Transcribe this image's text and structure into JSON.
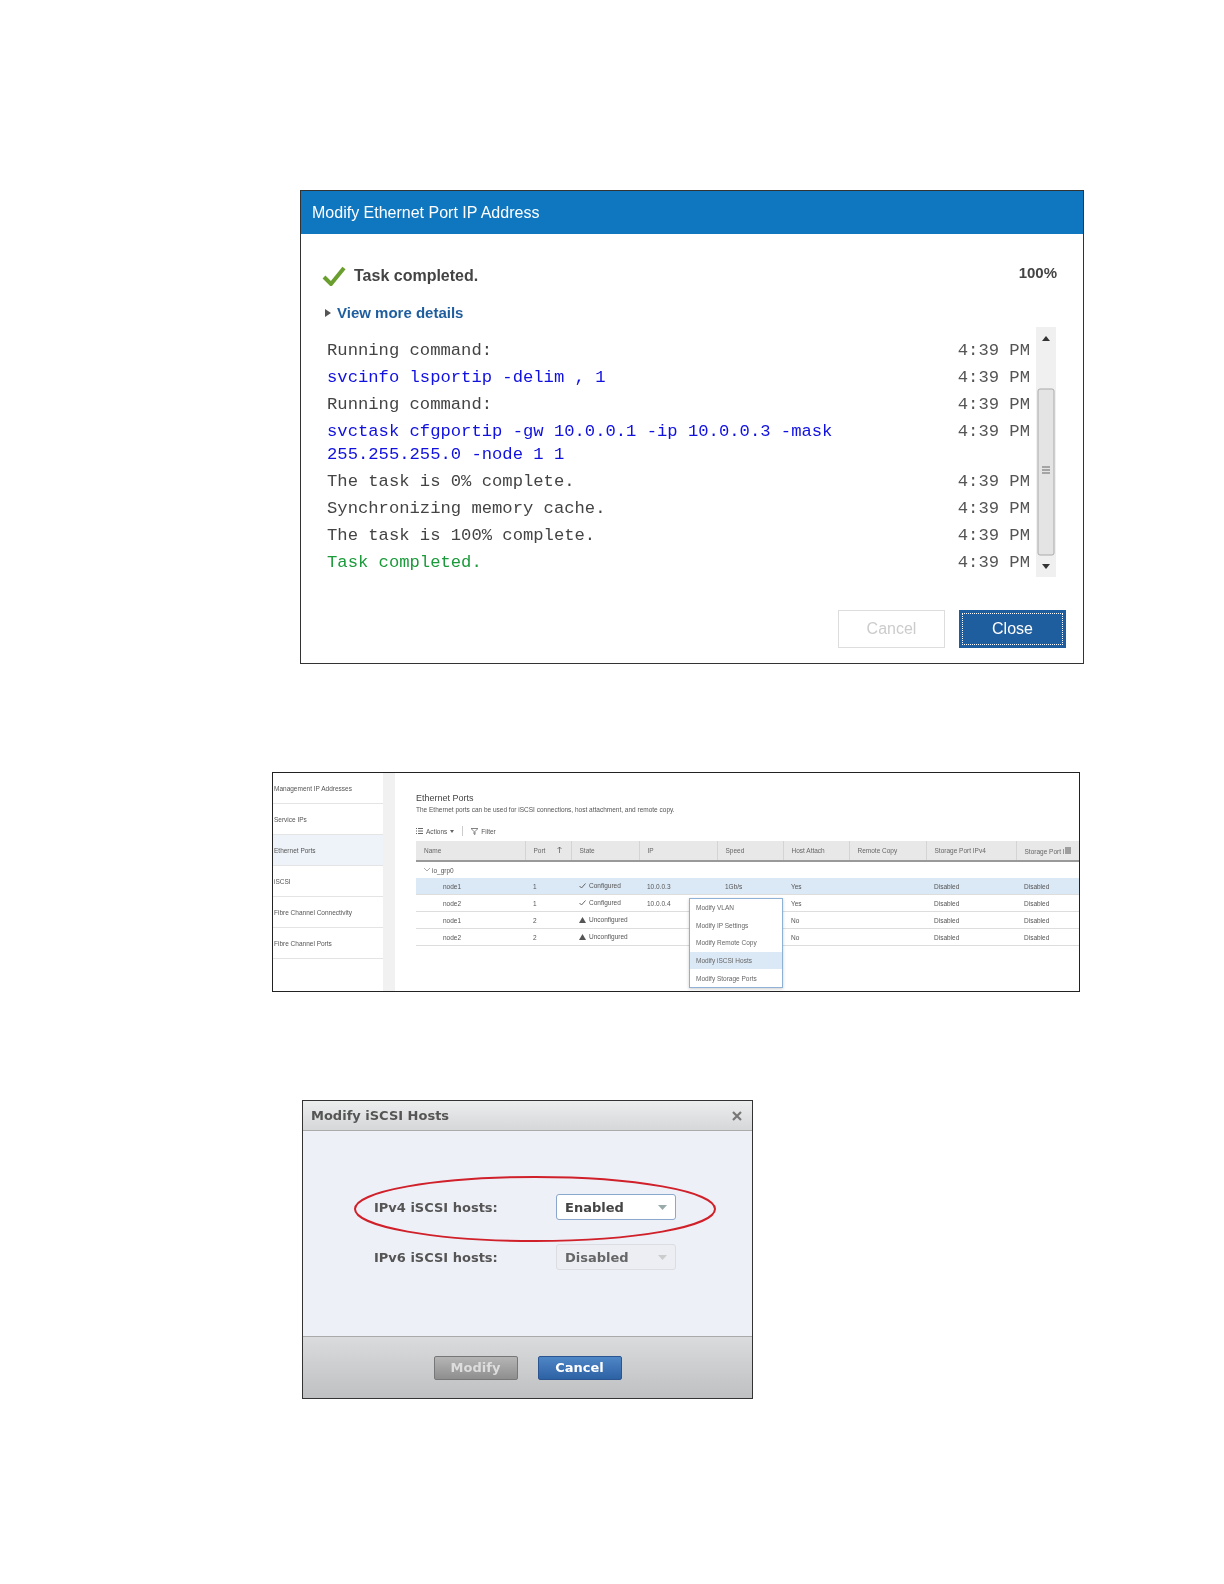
{
  "progress_dialog": {
    "title": "Modify Ethernet Port IP Address",
    "status": "Task completed.",
    "percent": "100%",
    "details_link": "View more details",
    "log": [
      {
        "kind": "info",
        "text": "Running command:",
        "time": "4:39 PM"
      },
      {
        "kind": "command",
        "text": "svcinfo lsportip -delim , 1",
        "time": "4:39 PM"
      },
      {
        "kind": "info",
        "text": "Running command:",
        "time": "4:39 PM"
      },
      {
        "kind": "command",
        "text": "svctask cfgportip -gw 10.0.0.1 -ip 10.0.0.3 -mask 255.255.255.0 -node 1 1",
        "time": "4:39 PM"
      },
      {
        "kind": "info",
        "text": "The task is 0% complete.",
        "time": "4:39 PM"
      },
      {
        "kind": "info",
        "text": "Synchronizing memory cache.",
        "time": "4:39 PM"
      },
      {
        "kind": "info",
        "text": "The task is 100% complete.",
        "time": "4:39 PM"
      },
      {
        "kind": "success",
        "text": "Task completed.",
        "time": "4:39 PM"
      }
    ],
    "buttons": [
      {
        "label": "Cancel",
        "disabled": true
      },
      {
        "label": "Close",
        "disabled": false
      }
    ]
  },
  "ethernet_ports": {
    "sidebar": {
      "items": [
        {
          "label": "Management IP Addresses",
          "selected": false
        },
        {
          "label": "Service IPs",
          "selected": false
        },
        {
          "label": "Ethernet Ports",
          "selected": true
        },
        {
          "label": "iSCSI",
          "selected": false
        },
        {
          "label": "Fibre Channel Connectivity",
          "selected": false
        },
        {
          "label": "Fibre Channel Ports",
          "selected": false
        }
      ]
    },
    "title": "Ethernet Ports",
    "description": "The Ethernet ports can be used for iSCSI connections, host attachment, and remote copy.",
    "toolbar": [
      {
        "kind": "actions",
        "label": "Actions"
      },
      {
        "kind": "filter",
        "label": "Filter"
      }
    ],
    "table": {
      "columns": [
        {
          "label": "Name",
          "sorted": false
        },
        {
          "label": "Port",
          "sorted": true
        },
        {
          "label": "State",
          "sorted": false
        },
        {
          "label": "IP",
          "sorted": false
        },
        {
          "label": "Speed",
          "sorted": false
        },
        {
          "label": "Host Attach",
          "sorted": false
        },
        {
          "label": "Remote Copy",
          "sorted": false
        },
        {
          "label": "Storage Port IPv4",
          "sorted": false
        },
        {
          "label": "Storage Port I",
          "sorted": false
        }
      ],
      "group": "io_grp0",
      "rows": [
        {
          "selected": true,
          "name": "node1",
          "port": "1",
          "state": {
            "kind": "configured",
            "text": "Configured"
          },
          "ip": "10.0.0.3",
          "speed": "1Gb/s",
          "host_attach": "Yes",
          "ipv4": "Disabled",
          "ipv6": "Disabled"
        },
        {
          "selected": false,
          "name": "node2",
          "port": "1",
          "state": {
            "kind": "configured",
            "text": "Configured"
          },
          "ip": "10.0.0.4",
          "host_attach": "Yes",
          "ipv4": "Disabled",
          "ipv6": "Disabled"
        },
        {
          "selected": false,
          "name": "node1",
          "port": "2",
          "state": {
            "kind": "unconfigured",
            "text": "Unconfigured"
          },
          "host_attach": "No",
          "ipv4": "Disabled",
          "ipv6": "Disabled"
        },
        {
          "selected": false,
          "name": "node2",
          "port": "2",
          "state": {
            "kind": "unconfigured",
            "text": "Unconfigured"
          },
          "host_attach": "No",
          "ipv4": "Disabled",
          "ipv6": "Disabled"
        }
      ]
    },
    "context_menu": [
      {
        "label": "Modify VLAN",
        "selected": false
      },
      {
        "label": "Modify IP Settings",
        "selected": false
      },
      {
        "label": "Modify Remote Copy",
        "selected": false
      },
      {
        "label": "Modify iSCSI Hosts",
        "selected": true
      },
      {
        "label": "Modify Storage Ports",
        "selected": false
      }
    ]
  },
  "iscsi_dialog": {
    "title": "Modify iSCSI Hosts",
    "fields": [
      {
        "label": "IPv4 iSCSI hosts:",
        "value": "Enabled",
        "disabled": false,
        "highlighted": true
      },
      {
        "label": "IPv6 iSCSI hosts:",
        "value": "Disabled",
        "disabled": true,
        "highlighted": false
      }
    ],
    "buttons": [
      {
        "label": "Modify",
        "kind": "secondary",
        "disabled": true
      },
      {
        "label": "Cancel",
        "kind": "primary",
        "disabled": false
      }
    ]
  }
}
